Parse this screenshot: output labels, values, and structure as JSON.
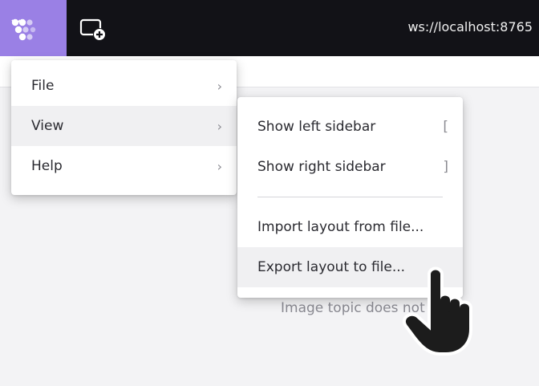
{
  "topbar": {
    "connection_url": "ws://localhost:8765"
  },
  "workspace": {
    "empty_message": "Image topic does not"
  },
  "menu": {
    "items": [
      {
        "label": "File",
        "arrow": "›"
      },
      {
        "label": "View",
        "arrow": "›"
      },
      {
        "label": "Help",
        "arrow": "›"
      }
    ]
  },
  "view_submenu": {
    "items": [
      {
        "label": "Show left sidebar",
        "shortcut": "["
      },
      {
        "label": "Show right sidebar",
        "shortcut": "]"
      },
      {
        "label": "Import layout from file..."
      },
      {
        "label": "Export layout to file..."
      }
    ]
  },
  "colors": {
    "topbar_bg": "#121217",
    "accent": "#9a80e5"
  },
  "icons": [
    "app-logo-icon",
    "chevron-down-icon",
    "add-layout-icon",
    "chevron-right-icon",
    "hand-pointer-cursor-icon"
  ]
}
